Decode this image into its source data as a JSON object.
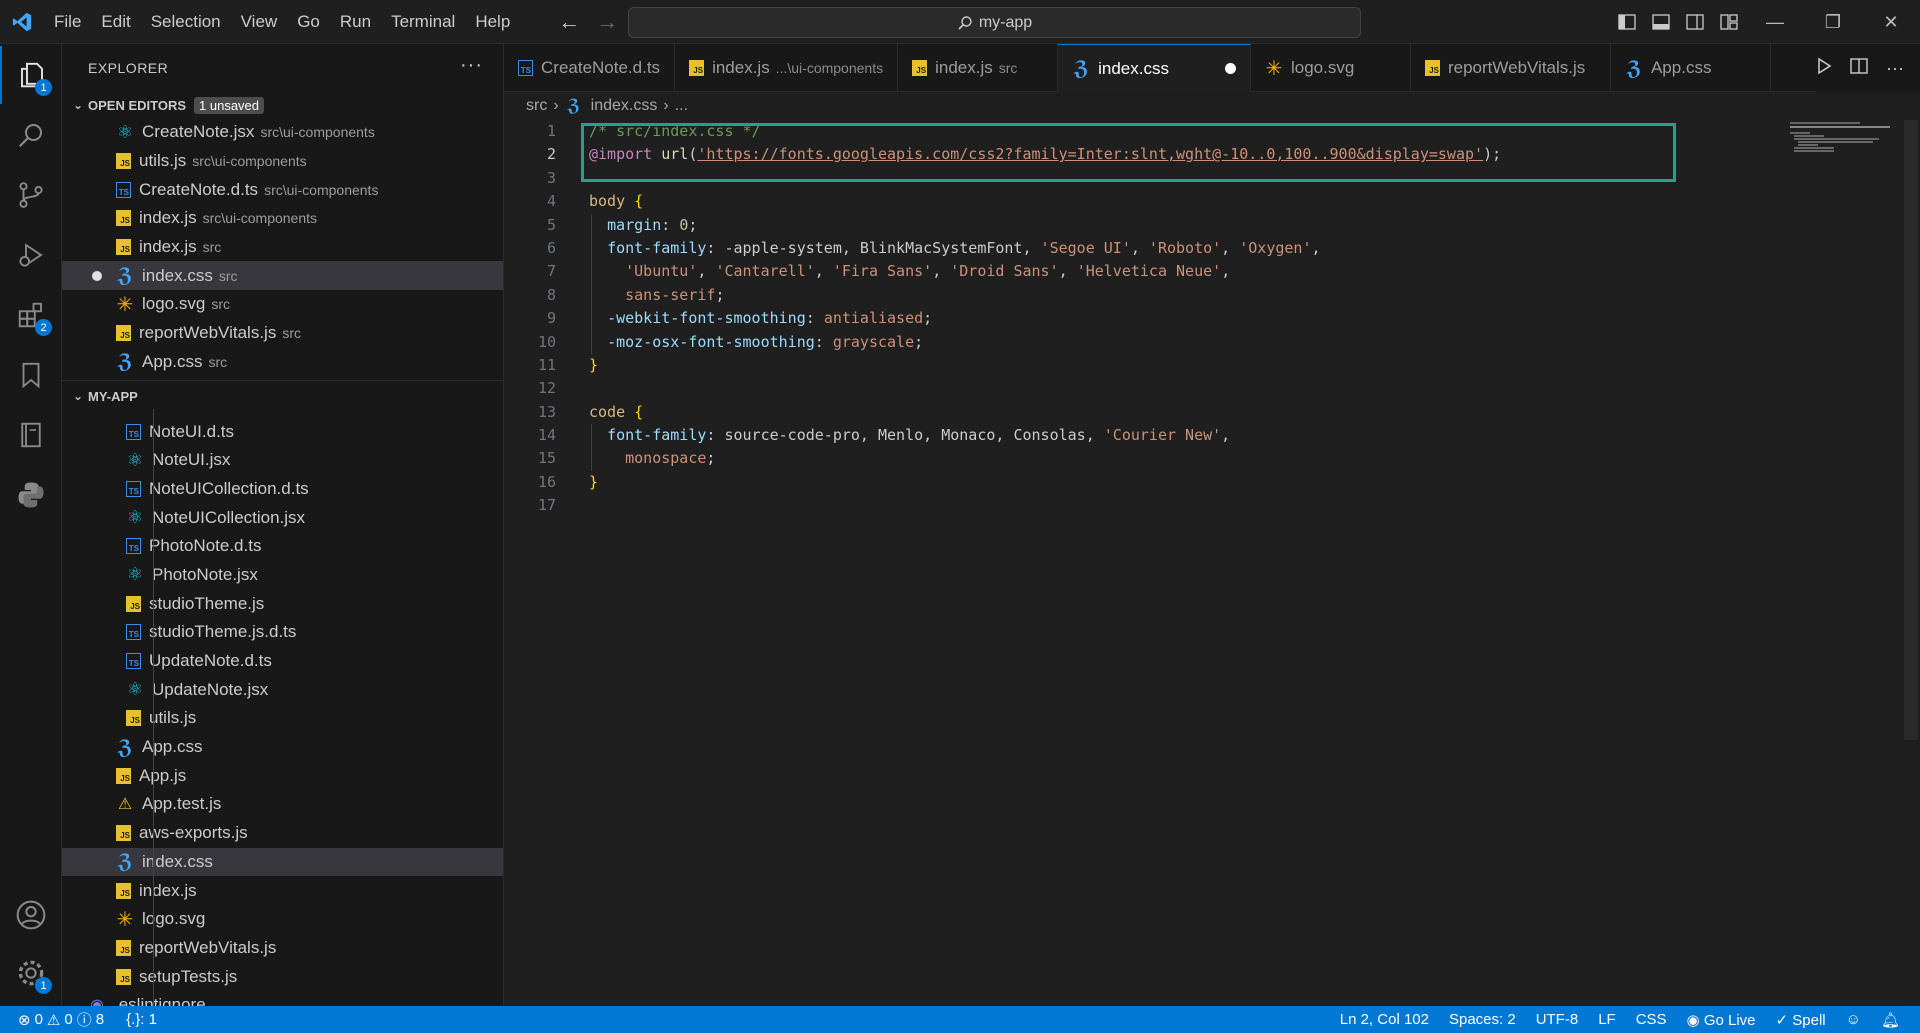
{
  "menu": [
    "File",
    "Edit",
    "Selection",
    "View",
    "Go",
    "Run",
    "Terminal",
    "Help"
  ],
  "search": {
    "text": "my-app"
  },
  "activity": {
    "explorer_badge": "1",
    "extensions_badge": "2",
    "settings_badge": "1"
  },
  "sidebar": {
    "title": "EXPLORER",
    "open_editors": {
      "label": "OPEN EDITORS",
      "badge": "1 unsaved",
      "items": [
        {
          "name": "CreateNote.jsx",
          "desc": "src\\ui-components",
          "icon": "react-icon"
        },
        {
          "name": "utils.js",
          "desc": "src\\ui-components",
          "icon": "js-icon"
        },
        {
          "name": "CreateNote.d.ts",
          "desc": "src\\ui-components",
          "icon": "ts-icon"
        },
        {
          "name": "index.js",
          "desc": "src\\ui-components",
          "icon": "js-icon"
        },
        {
          "name": "index.js",
          "desc": "src",
          "icon": "js-icon"
        },
        {
          "name": "index.css",
          "desc": "src",
          "icon": "css-icon"
        },
        {
          "name": "logo.svg",
          "desc": "src",
          "icon": "svg-icon"
        },
        {
          "name": "reportWebVitals.js",
          "desc": "src",
          "icon": "js-icon"
        },
        {
          "name": "App.css",
          "desc": "src",
          "icon": "css-icon"
        }
      ]
    },
    "project": {
      "label": "MY-APP",
      "nested": [
        {
          "name": "NoteUI.d.ts",
          "icon": "ts-icon"
        },
        {
          "name": "NoteUI.jsx",
          "icon": "react-icon"
        },
        {
          "name": "NoteUICollection.d.ts",
          "icon": "ts-icon"
        },
        {
          "name": "NoteUICollection.jsx",
          "icon": "react-icon"
        },
        {
          "name": "PhotoNote.d.ts",
          "icon": "ts-icon"
        },
        {
          "name": "PhotoNote.jsx",
          "icon": "react-icon"
        },
        {
          "name": "studioTheme.js",
          "icon": "js-icon"
        },
        {
          "name": "studioTheme.js.d.ts",
          "icon": "ts-icon"
        },
        {
          "name": "UpdateNote.d.ts",
          "icon": "ts-icon"
        },
        {
          "name": "UpdateNote.jsx",
          "icon": "react-icon"
        },
        {
          "name": "utils.js",
          "icon": "js-icon"
        }
      ],
      "files": [
        {
          "name": "App.css",
          "icon": "css-icon"
        },
        {
          "name": "App.js",
          "icon": "js-icon"
        },
        {
          "name": "App.test.js",
          "icon": "test-icon"
        },
        {
          "name": "aws-exports.js",
          "icon": "js-icon"
        },
        {
          "name": "index.css",
          "icon": "css-icon"
        },
        {
          "name": "index.js",
          "icon": "js-icon"
        },
        {
          "name": "logo.svg",
          "icon": "svg-icon"
        },
        {
          "name": "reportWebVitals.js",
          "icon": "js-icon"
        },
        {
          "name": "setupTests.js",
          "icon": "js-icon"
        }
      ],
      "last": ".eslintignore"
    }
  },
  "tabs": [
    {
      "name": "CreateNote.d.ts",
      "desc": "",
      "icon": "ts-icon"
    },
    {
      "name": "index.js",
      "desc": "...\\ui-components",
      "icon": "js-icon"
    },
    {
      "name": "index.js",
      "desc": "src",
      "icon": "js-icon"
    },
    {
      "name": "index.css",
      "desc": "",
      "icon": "css-icon"
    },
    {
      "name": "logo.svg",
      "desc": "",
      "icon": "svg-icon"
    },
    {
      "name": "reportWebVitals.js",
      "desc": "",
      "icon": "js-icon"
    },
    {
      "name": "App.css",
      "desc": "",
      "icon": "css-icon"
    }
  ],
  "breadcrumb": {
    "folder": "src",
    "file": "index.css",
    "more": "..."
  },
  "editor": {
    "line_numbers": [
      "1",
      "2",
      "3",
      "4",
      "5",
      "6",
      "7",
      "8",
      "9",
      "10",
      "11",
      "12",
      "13",
      "14",
      "15",
      "16",
      "17"
    ],
    "lines": [
      "/* src/index.css */",
      "@import url('https://fonts.googleapis.com/css2?family=Inter:slnt,wght@-10..0,100..900&display=swap');",
      "",
      "body {",
      "  margin: 0;",
      "  font-family: -apple-system, BlinkMacSystemFont, 'Segoe UI', 'Roboto', 'Oxygen',",
      "    'Ubuntu', 'Cantarell', 'Fira Sans', 'Droid Sans', 'Helvetica Neue',",
      "    sans-serif;",
      "  -webkit-font-smoothing: antialiased;",
      "  -moz-osx-font-smoothing: grayscale;",
      "}",
      "",
      "code {",
      "  font-family: source-code-pro, Menlo, Monaco, Consolas, 'Courier New',",
      "    monospace;",
      "}",
      ""
    ]
  },
  "status": {
    "errors": "0",
    "warnings": "0",
    "info": "8",
    "braces": "{.}: 1",
    "position": "Ln 2, Col 102",
    "spaces": "Spaces: 2",
    "encoding": "UTF-8",
    "eol": "LF",
    "language": "CSS",
    "golive": "Go Live",
    "spell": "Spell"
  },
  "colors": {
    "accent": "#0078d4",
    "highlight_box": "#1fa38a"
  }
}
